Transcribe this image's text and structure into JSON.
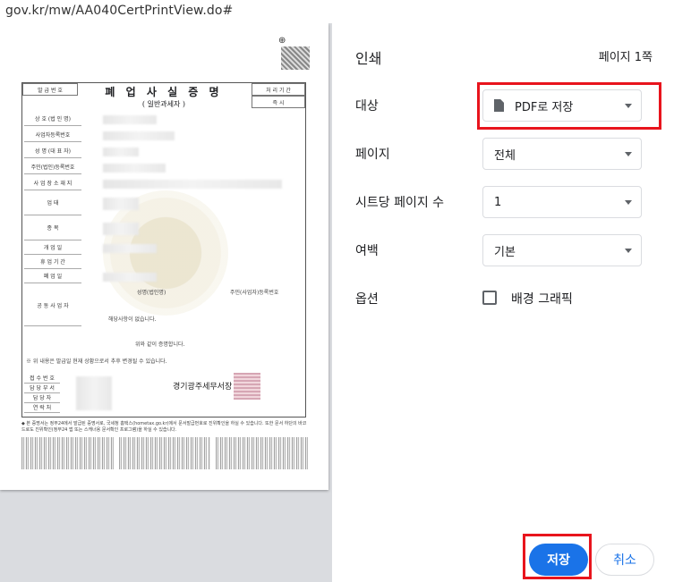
{
  "address_bar": {
    "url": "gov.kr/mw/AA040CertPrintView.do#"
  },
  "preview": {
    "document": {
      "issue_no_label": "발 급 번 호",
      "title": "폐 업 사 실 증 명",
      "subtitle": "( 일반과세자 )",
      "processing_label": "처 리 기 간",
      "processing_value": "즉    시",
      "rows": [
        "상 호 (법 인 명)",
        "사업자등록번호",
        "성 명 (대 표 자)",
        "주민(법인)등록번호",
        "사 업 장 소 재 지",
        "업          태",
        "종          목",
        "개    업    일",
        "휴  업  기  간",
        "폐    업    일",
        "공 동 사 업 자"
      ],
      "joint_col1": "성명(법인명)",
      "joint_col2": "주민(사업자)등록번호",
      "joint_none": "해당사항이 없습니다.",
      "certify_text": "위와 같이 증명합니다.",
      "note_text": "※ 위 내용은 발급일 현재 상황으로서 추후 변경될 수 있습니다.",
      "office_name": "경기광주세무서장",
      "bottom_rows": [
        "접 수 번 호",
        "담 당 부 서",
        "담   당   자",
        "연   락   처"
      ],
      "footnote": "◆ 본 증명서는 정부24에서 발급된 증명서로, 국세청 홈택스(hometax.go.kr)에서 문서발급번호로 진위확인을 하실 수 있습니다. 또한 문서 하단의 바코드로도 진위확인(정부24 앱 또는 스캐너용 문서확인 프로그램)을 하실 수 있습니다."
    }
  },
  "settings": {
    "title": "인쇄",
    "page_count": "페이지 1쪽",
    "destination": {
      "label": "대상",
      "value": "PDF로 저장"
    },
    "pages": {
      "label": "페이지",
      "value": "전체"
    },
    "pages_per_sheet": {
      "label": "시트당 페이지 수",
      "value": "1"
    },
    "margins": {
      "label": "여백",
      "value": "기본"
    },
    "options": {
      "label": "옵션",
      "background_graphics": "배경 그래픽",
      "background_checked": false
    },
    "save_button": "저장",
    "cancel_button": "취소"
  },
  "colors": {
    "accent": "#1a73e8",
    "highlight": "#e8141d"
  }
}
